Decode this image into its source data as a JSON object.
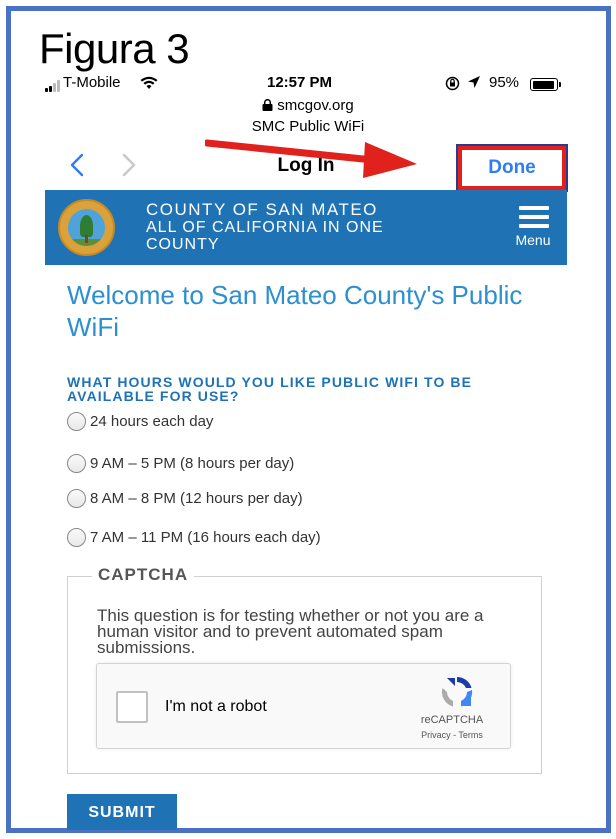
{
  "figure_label": "Figura 3",
  "status_bar": {
    "carrier": "T-Mobile",
    "time": "12:57 PM",
    "battery": "95%",
    "battery_level": 0.95
  },
  "browser": {
    "domain": "smcgov.org",
    "page_site": "SMC Public WiFi",
    "nav_title": "Log In",
    "done_label": "Done",
    "back_glyph": "<",
    "forward_glyph": ">"
  },
  "header": {
    "line1": "COUNTY OF SAN MATEO",
    "line2": "ALL OF CALIFORNIA IN ONE",
    "line3": "COUNTY",
    "menu_label": "Menu",
    "seal_text": "COUNTY OF SAN MATEO CALIFORNIA"
  },
  "welcome_title": "Welcome to San Mateo County's Public WiFi",
  "question": "WHAT HOURS WOULD YOU LIKE PUBLIC WIFI TO BE AVAILABLE FOR USE?",
  "options": [
    "24 hours each day",
    "9 AM – 5 PM (8 hours per day)",
    "8 AM – 8 PM (12 hours per day)",
    "7 AM – 11 PM (16 hours each day)"
  ],
  "captcha": {
    "legend": "CAPTCHA",
    "description": "This question is for testing whether or not you are a human visitor and to prevent automated spam submissions.",
    "checkbox_label": "I'm not a robot",
    "brand": "reCAPTCHA",
    "links": "Privacy - Terms"
  },
  "submit_label": "SUBMIT",
  "colors": {
    "frame": "#4a72c4",
    "header_blue": "#1f73b5",
    "link_blue": "#2f7cf6",
    "highlight_red": "#e0211c",
    "title_blue": "#2b8fd0"
  }
}
